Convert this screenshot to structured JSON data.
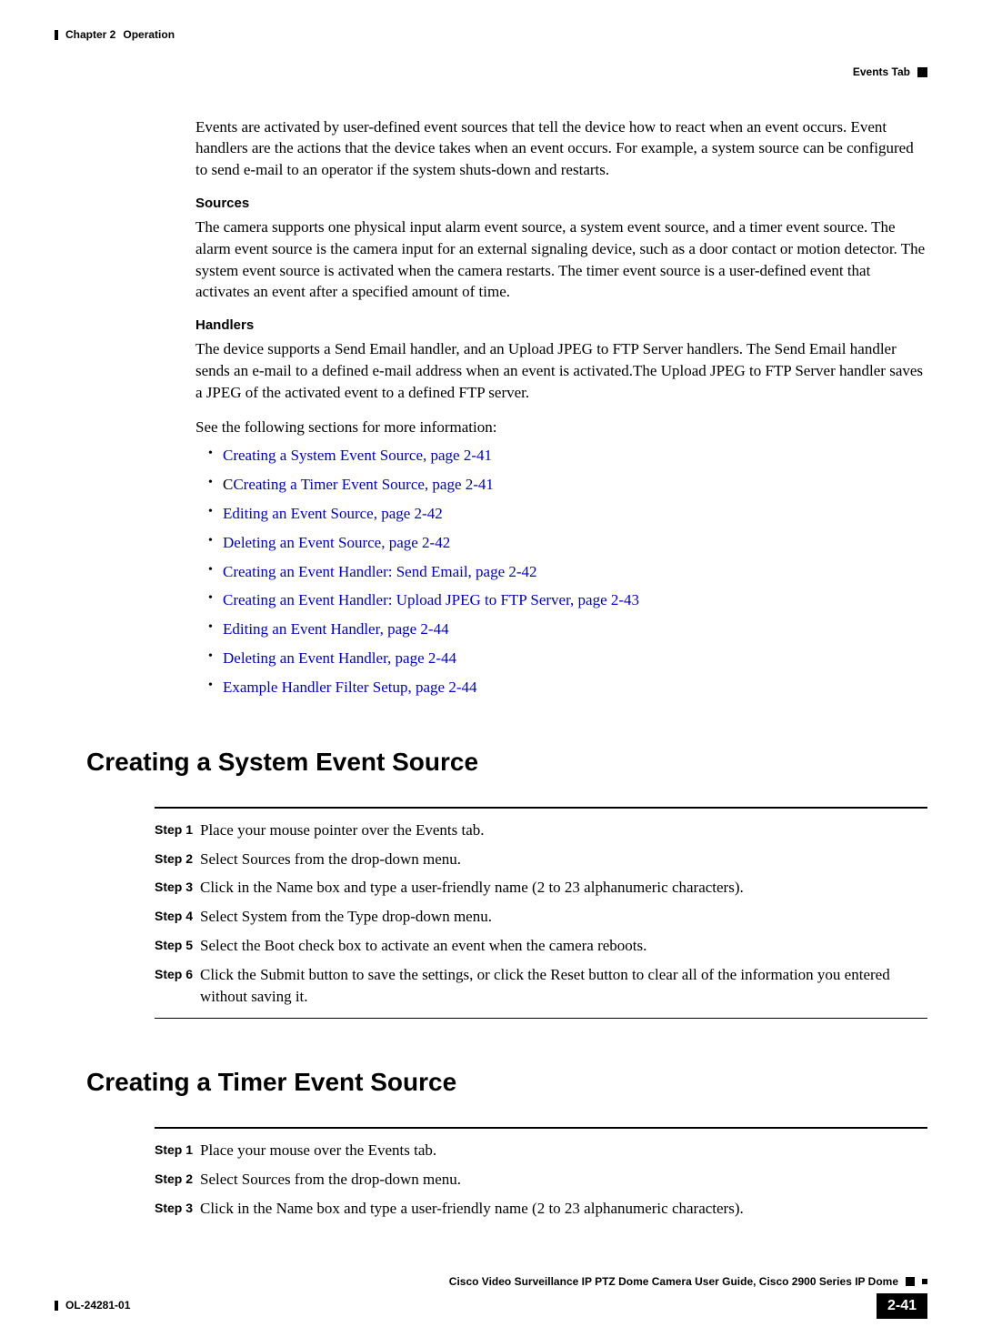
{
  "header": {
    "chapter_label": "Chapter 2",
    "chapter_title": "Operation",
    "tab_label": "Events Tab"
  },
  "intro": {
    "para": "Events are activated by user-defined event sources that tell the device how to react when an event occurs. Event handlers are the actions that the device takes when an event occurs. For example, a system source can be configured to send e-mail to an operator if the system shuts-down and restarts.",
    "sources_head": "Sources",
    "sources_para": "The camera supports one physical input alarm event source, a system event source, and a timer event source. The alarm event source is the camera input for an external signaling device, such as a door contact or motion detector. The system event source is activated when the camera restarts. The timer event source is a user-defined event that activates an event after a specified amount of time.",
    "handlers_head": "Handlers",
    "handlers_para": "The device supports a Send Email handler, and an Upload JPEG to FTP Server handlers. The Send Email handler sends an e-mail to a defined e-mail address when an event is activated.The Upload JPEG to FTP Server handler saves a JPEG of the activated event to a defined FTP server.",
    "see_more": "See the following sections for more information:"
  },
  "links": [
    "Creating a System Event Source, page 2-41",
    "Creating a Timer Event Source, page 2-41",
    "Editing an Event Source, page 2-42",
    "Deleting an Event Source, page 2-42",
    "Creating an Event Handler: Send Email, page 2-42",
    "Creating an Event Handler: Upload JPEG to FTP Server, page 2-43",
    "Editing an Event Handler, page 2-44",
    "Deleting an Event Handler, page 2-44",
    "Example Handler Filter Setup, page 2-44"
  ],
  "section1": {
    "title": "Creating a System Event Source",
    "steps": [
      {
        "label": "Step 1",
        "text": "Place your mouse pointer over the Events tab."
      },
      {
        "label": "Step 2",
        "text": "Select Sources from the drop-down menu."
      },
      {
        "label": "Step 3",
        "text": "Click in the Name box and type a user-friendly name (2 to 23 alphanumeric characters)."
      },
      {
        "label": "Step 4",
        "text": "Select System from the Type drop-down menu."
      },
      {
        "label": "Step 5",
        "text": "Select the Boot check box to activate an event when the camera reboots."
      },
      {
        "label": "Step 6",
        "text": "Click the Submit button to save the settings, or click the Reset button to clear all of the information you entered without saving it."
      }
    ]
  },
  "section2": {
    "title": "Creating a Timer Event Source",
    "steps": [
      {
        "label": "Step 1",
        "text": "Place your mouse over the Events tab."
      },
      {
        "label": "Step 2",
        "text": "Select Sources from the drop-down menu."
      },
      {
        "label": "Step 3",
        "text": "Click in the Name box and type a user-friendly name (2 to 23 alphanumeric characters)."
      }
    ]
  },
  "footer": {
    "guide": "Cisco Video Surveillance IP PTZ Dome Camera User Guide, Cisco 2900 Series IP Dome",
    "doc_id": "OL-24281-01",
    "page": "2-41"
  },
  "link2_prefix": "C"
}
